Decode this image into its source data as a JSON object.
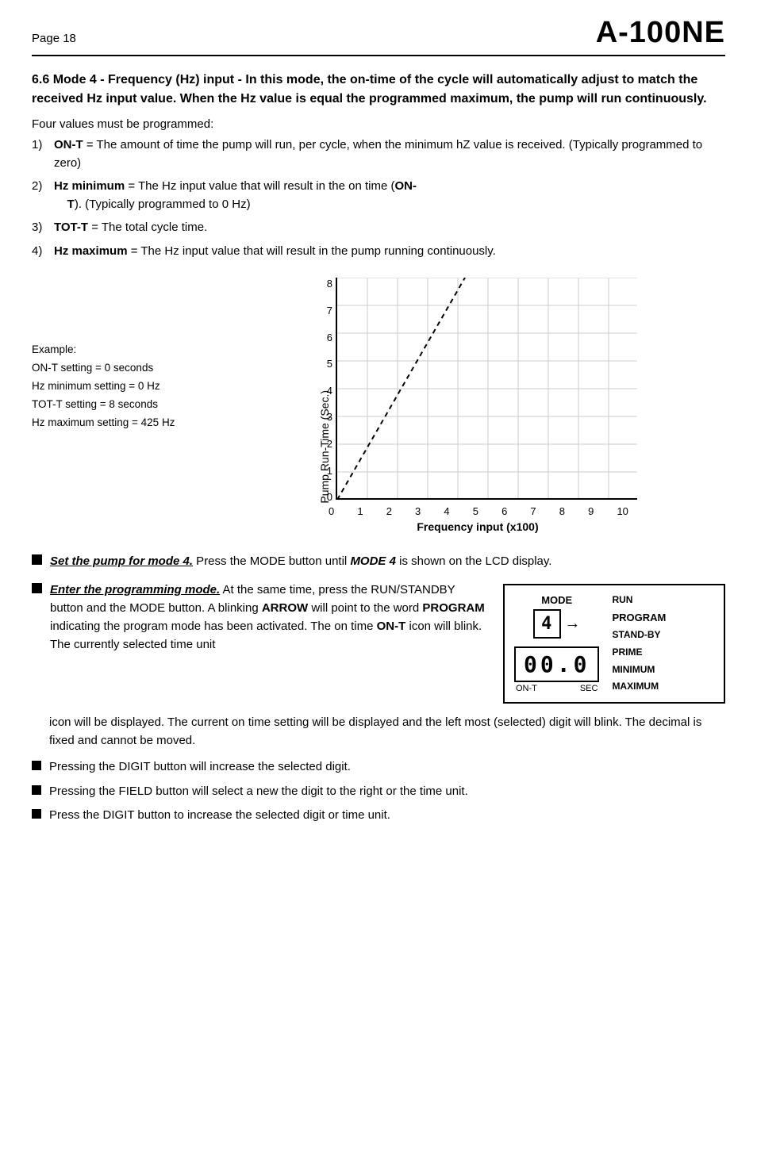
{
  "header": {
    "page": "Page 18",
    "title": "A-100NE"
  },
  "section": {
    "heading": "6.6 Mode 4 - Frequency (Hz) input",
    "intro": "In this mode, the on-time of the cycle will automatically adjust to match the received Hz input value. When the Hz value is equal the programmed maximum, the pump will run continuously.",
    "four_values": "Four values must be programmed:",
    "list": [
      {
        "num": "1)",
        "label": "ON-T",
        "text": " = The amount of time the pump will run, per cycle, when the minimum hZ value is received. (Typically programmed to zero)"
      },
      {
        "num": "2)",
        "label": "Hz minimum",
        "text": " = The Hz input value that will result in the on time (",
        "label2": "ON-T",
        "text2": "). (Typically programmed to 0 Hz)"
      },
      {
        "num": "3)",
        "label": "TOT-T",
        "text": " = The total cycle time."
      },
      {
        "num": "4)",
        "label": "Hz maximum",
        "text": " = The Hz input value that will result in the pump running continuously."
      }
    ],
    "chart": {
      "y_label": "Pump Run-Time (Sec.)",
      "x_label": "Frequency input (x100)",
      "y_ticks": [
        "0",
        "1",
        "2",
        "3",
        "4",
        "5",
        "6",
        "7",
        "8"
      ],
      "x_ticks": [
        "0",
        "1",
        "2",
        "3",
        "4",
        "5",
        "6",
        "7",
        "8",
        "9",
        "10"
      ],
      "example_label": "Example:",
      "example_lines": [
        "ON-T setting = 0 seconds",
        "Hz minimum setting = 0 Hz",
        "TOT-T setting = 8 seconds",
        "Hz maximum setting = 425 Hz"
      ]
    },
    "bullets": [
      {
        "id": "set-pump",
        "italic_bold": "Set the pump for mode 4.",
        "text": " Press the MODE button until ",
        "bold": "MODE 4",
        "text2": " is shown on the LCD display."
      },
      {
        "id": "enter-programming",
        "italic_bold": "Enter the programming mode.",
        "text": " At the same time, press the RUN/STANDBY button and the MODE button. A blinking ",
        "bold1": "ARROW",
        "text2": " will point to the word ",
        "bold2": "PROGRAM",
        "text3": " indicating the program mode has been activated. The on time ",
        "bold3": "ON-T",
        "text4": " icon will blink. The currently selected time unit"
      }
    ],
    "device": {
      "mode_label": "MODE",
      "mode_value": "4",
      "display_value": "00.0",
      "ont_label": "ON-T",
      "sec_label": "SEC",
      "arrow": "→",
      "right_labels": [
        "RUN",
        "PROGRAM",
        "STAND-BY",
        "PRIME",
        "MINIMUM",
        "MAXIMUM"
      ]
    },
    "continued": "icon will be displayed. The current on time setting will be displayed and the left most (selected) digit will blink.  The decimal is fixed and cannot be moved.",
    "small_bullets": [
      "Pressing the DIGIT button will increase the selected digit.",
      "Pressing the FIELD button will select a new the digit to the right or the time unit.",
      "Press the DIGIT button to increase the selected digit or time unit."
    ]
  }
}
